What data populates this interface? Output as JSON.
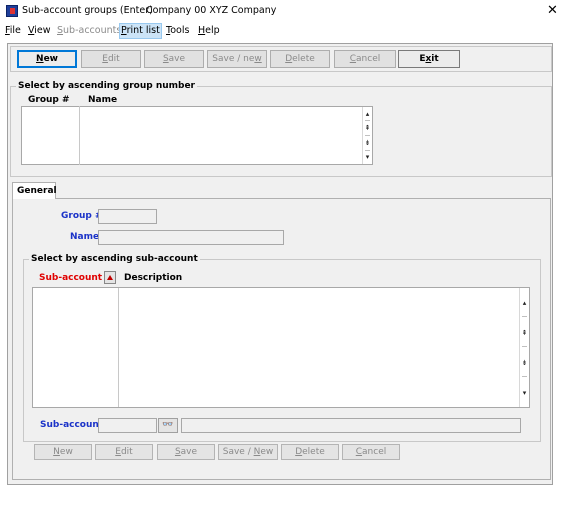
{
  "window": {
    "title": "Sub-account groups (Enter)",
    "company": "Company 00 XYZ Company",
    "close_glyph": "✕"
  },
  "menu": {
    "items": [
      {
        "label": "File",
        "ul": "F",
        "rest": "ile"
      },
      {
        "label": "View",
        "ul": "V",
        "rest": "iew"
      },
      {
        "label": "Sub-accounts",
        "ul": "S",
        "rest": "ub-accounts"
      },
      {
        "label": "Print list",
        "ul": "P",
        "rest": "rint list"
      },
      {
        "label": "Tools",
        "ul": "T",
        "rest": "ools"
      },
      {
        "label": "Help",
        "ul": "H",
        "rest": "elp"
      }
    ]
  },
  "toolbar": {
    "new": {
      "ul": "N",
      "rest": "ew"
    },
    "edit": {
      "ul": "E",
      "rest": "dit"
    },
    "save": {
      "ul": "S",
      "rest": "ave"
    },
    "save_new": {
      "pre": "Save / ne",
      "ul": "w"
    },
    "delete": {
      "ul": "D",
      "rest": "elete"
    },
    "cancel": {
      "ul": "C",
      "rest": "ancel"
    },
    "exit": {
      "pre": "E",
      "ul": "x",
      "rest": "it"
    }
  },
  "group_select": {
    "title": "Select by ascending group number",
    "col_group": "Group #",
    "col_name": "Name",
    "rows": []
  },
  "tabs": {
    "general": "General"
  },
  "form": {
    "group_label": "Group #",
    "name_label": "Name",
    "group_value": "",
    "name_value": ""
  },
  "sub_select": {
    "title": "Select by ascending sub-account",
    "col_sub": "Sub-account",
    "col_desc": "Description",
    "rows": []
  },
  "sub_entry": {
    "label": "Sub-account",
    "value": "",
    "description": "",
    "lookup_icon": "👓"
  },
  "bottom_buttons": {
    "new": {
      "ul": "N",
      "rest": "ew"
    },
    "edit": {
      "ul": "E",
      "rest": "dit"
    },
    "save": {
      "ul": "S",
      "rest": "ave"
    },
    "save_new": {
      "pre": "Save / ",
      "ul": "N",
      "rest": "ew"
    },
    "delete": {
      "ul": "D",
      "rest": "elete"
    },
    "cancel": {
      "ul": "C",
      "rest": "ancel"
    }
  },
  "scroll_glyphs": {
    "top": "▴",
    "page_up": "⇞",
    "page_down": "⇟",
    "bottom": "▾"
  },
  "colors": {
    "accent_blue": "#1a32c8",
    "required_red": "#e00000",
    "menu_highlight": "#cce4f7"
  }
}
